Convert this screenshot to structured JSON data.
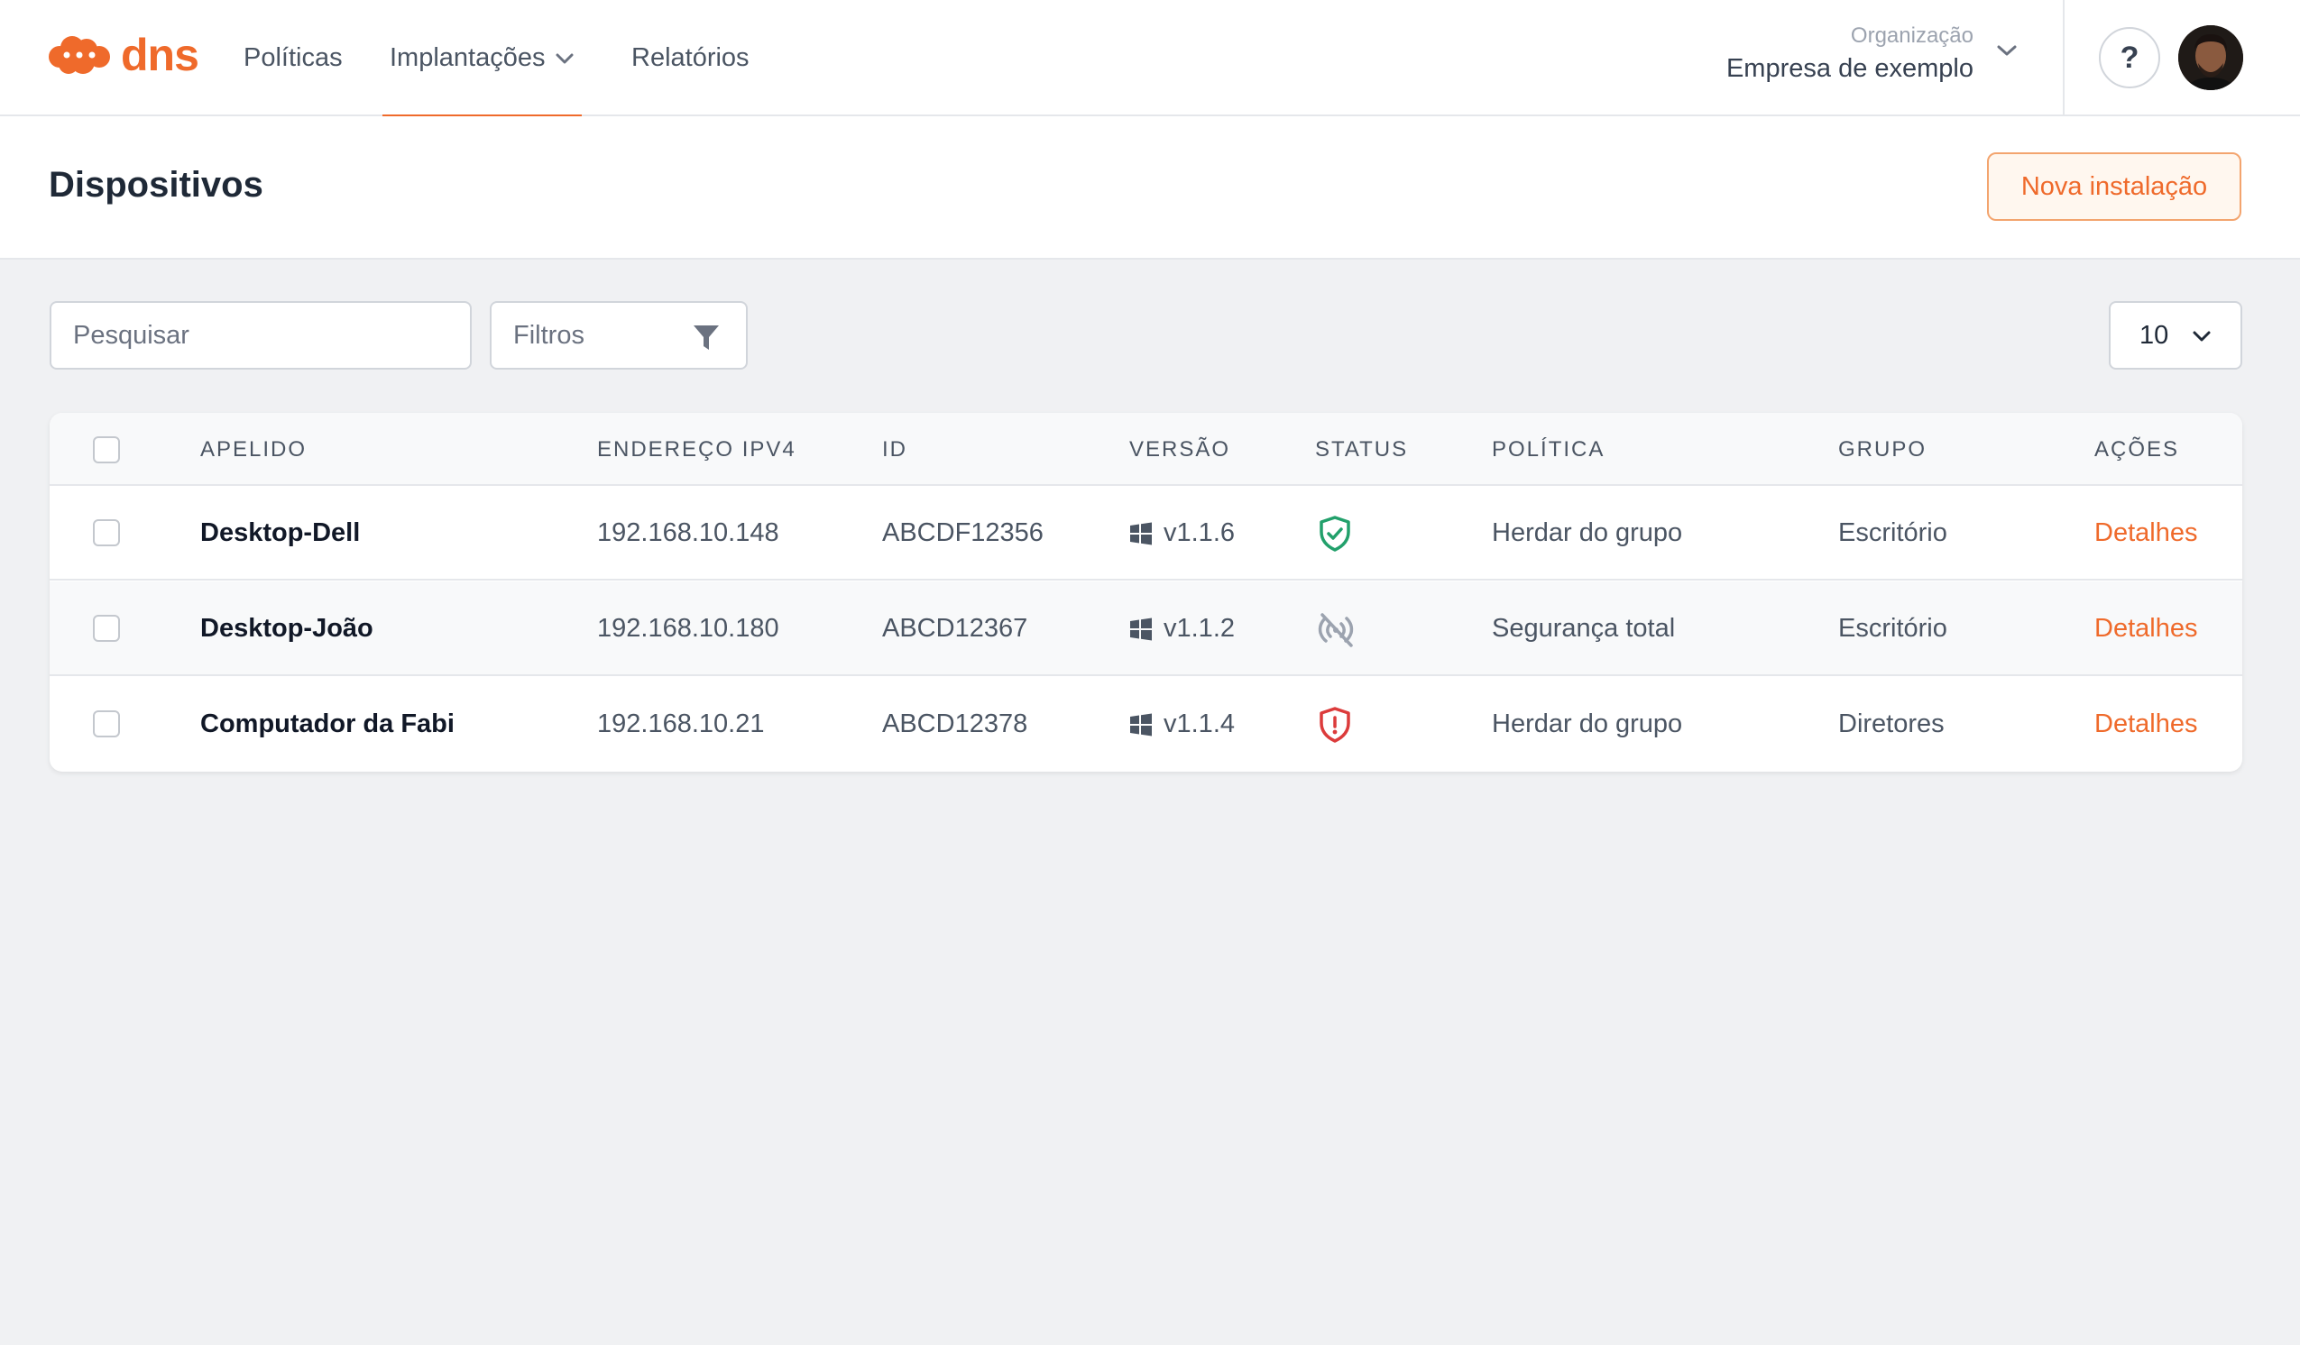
{
  "nav": {
    "logo_text": "dns",
    "items": [
      {
        "label": "Políticas",
        "active": false
      },
      {
        "label": "Implantações",
        "active": true,
        "has_dropdown": true
      },
      {
        "label": "Relatórios",
        "active": false
      }
    ],
    "org_label": "Organização",
    "org_name": "Empresa de exemplo",
    "help_label": "?"
  },
  "page": {
    "title": "Dispositivos",
    "new_button": "Nova instalação"
  },
  "toolbar": {
    "search_placeholder": "Pesquisar",
    "filters_label": "Filtros",
    "per_page": "10"
  },
  "table": {
    "headers": [
      "APELIDO",
      "ENDEREÇO IPV4",
      "ID",
      "VERSÃO",
      "STATUS",
      "POLÍTICA",
      "GRUPO",
      "AÇÕES"
    ],
    "rows": [
      {
        "name": "Desktop-Dell",
        "ip": "192.168.10.148",
        "id": "ABCDF12356",
        "os": "windows",
        "version": "v1.1.6",
        "status": "protected",
        "policy": "Herdar do grupo",
        "group": "Escritório",
        "action": "Detalhes"
      },
      {
        "name": "Desktop-João",
        "ip": "192.168.10.180",
        "id": "ABCD12367",
        "os": "windows",
        "version": "v1.1.2",
        "status": "offline",
        "policy": "Segurança total",
        "group": "Escritório",
        "action": "Detalhes"
      },
      {
        "name": "Computador da Fabi",
        "ip": "192.168.10.21",
        "id": "ABCD12378",
        "os": "windows",
        "version": "v1.1.4",
        "status": "alert",
        "policy": "Herdar do grupo",
        "group": "Diretores",
        "action": "Detalhes"
      }
    ]
  },
  "colors": {
    "brand": "#ef6a2b",
    "status_protected": "#22a06b",
    "status_offline": "#9ca3af",
    "status_alert": "#dc3b3b"
  }
}
